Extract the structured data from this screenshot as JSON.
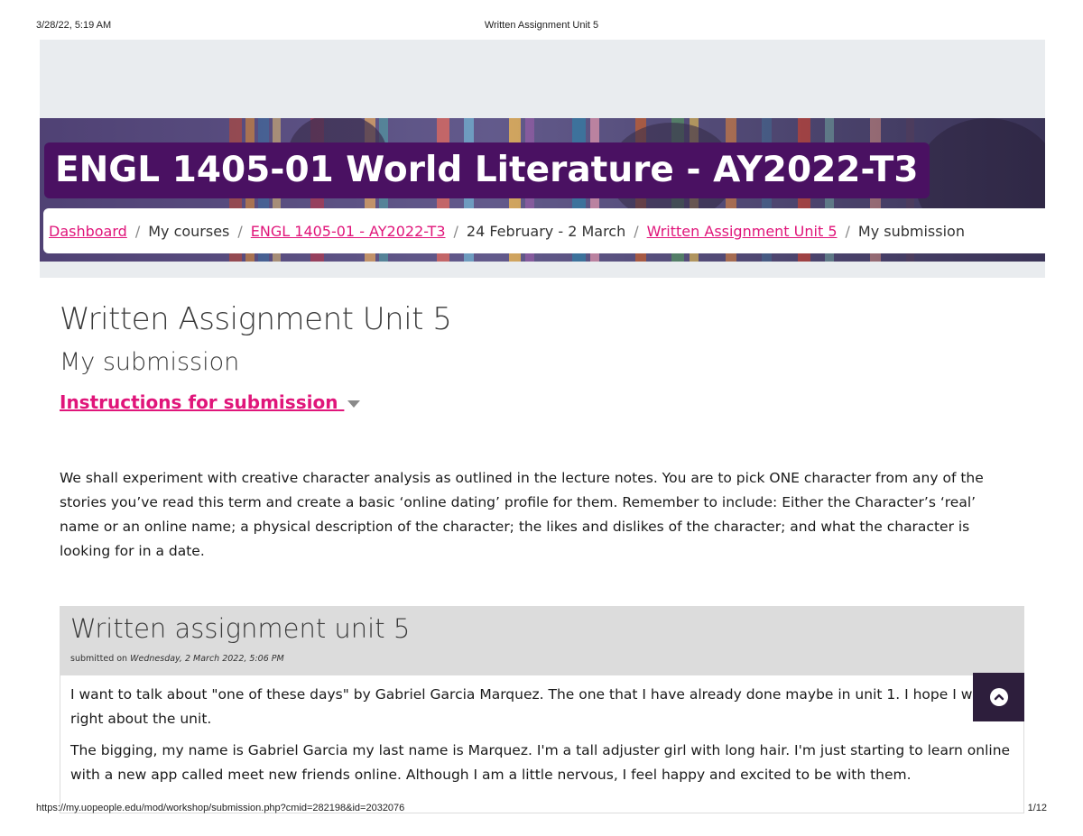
{
  "print_header": {
    "date": "3/28/22, 5:19 AM",
    "title": "Written Assignment Unit 5"
  },
  "print_footer": {
    "url": "https://my.uopeople.edu/mod/workshop/submission.php?cmid=282198&id=2032076",
    "pages": "1/12"
  },
  "course": {
    "title": "ENGL 1405-01 World Literature - AY2022-T3"
  },
  "breadcrumb": {
    "items": [
      {
        "label": "Dashboard",
        "link": true
      },
      {
        "label": "My courses",
        "link": false
      },
      {
        "label": "ENGL 1405-01 - AY2022-T3",
        "link": true
      },
      {
        "label": "24 February - 2 March",
        "link": false
      },
      {
        "label": "Written Assignment Unit 5",
        "link": true
      },
      {
        "label": "My submission",
        "link": false
      }
    ],
    "separator": "/"
  },
  "page": {
    "heading": "Written Assignment Unit 5",
    "subheading": "My submission",
    "instructions_link": "Instructions for submission",
    "instructions_text": "We shall experiment with creative character analysis as outlined in the lecture notes. You are to pick ONE character from any of the stories you’ve read this term and create a basic ‘online dating’ profile for them.   Remember to include: Either the Character’s ‘real’ name or an online name; a physical description of the character; the likes and dislikes of the character; and what the character is looking for in a date."
  },
  "submission": {
    "title": "Written assignment unit 5",
    "meta_prefix": "submitted on",
    "meta_date": "Wednesday, 2 March 2022, 5:06 PM",
    "paragraphs": [
      "I want to talk about \"one of these days\" by Gabriel Garcia Marquez. The one that I have already done maybe in unit 1. I hope I was right about the unit.",
      "The bigging, my name is Gabriel Garcia my last name is Marquez. I'm a tall adjuster girl with long hair. I'm just starting to learn online with a new app called meet new friends online. Although I am a little nervous, I feel happy and excited to be with them."
    ]
  },
  "colors": {
    "accent": "#e0157a",
    "course_title_bg": "#4a1162",
    "scroll_button_bg": "#2d1e3c"
  },
  "icons": {
    "caret": "caret-down-icon",
    "scroll_top": "chevron-up-icon"
  }
}
